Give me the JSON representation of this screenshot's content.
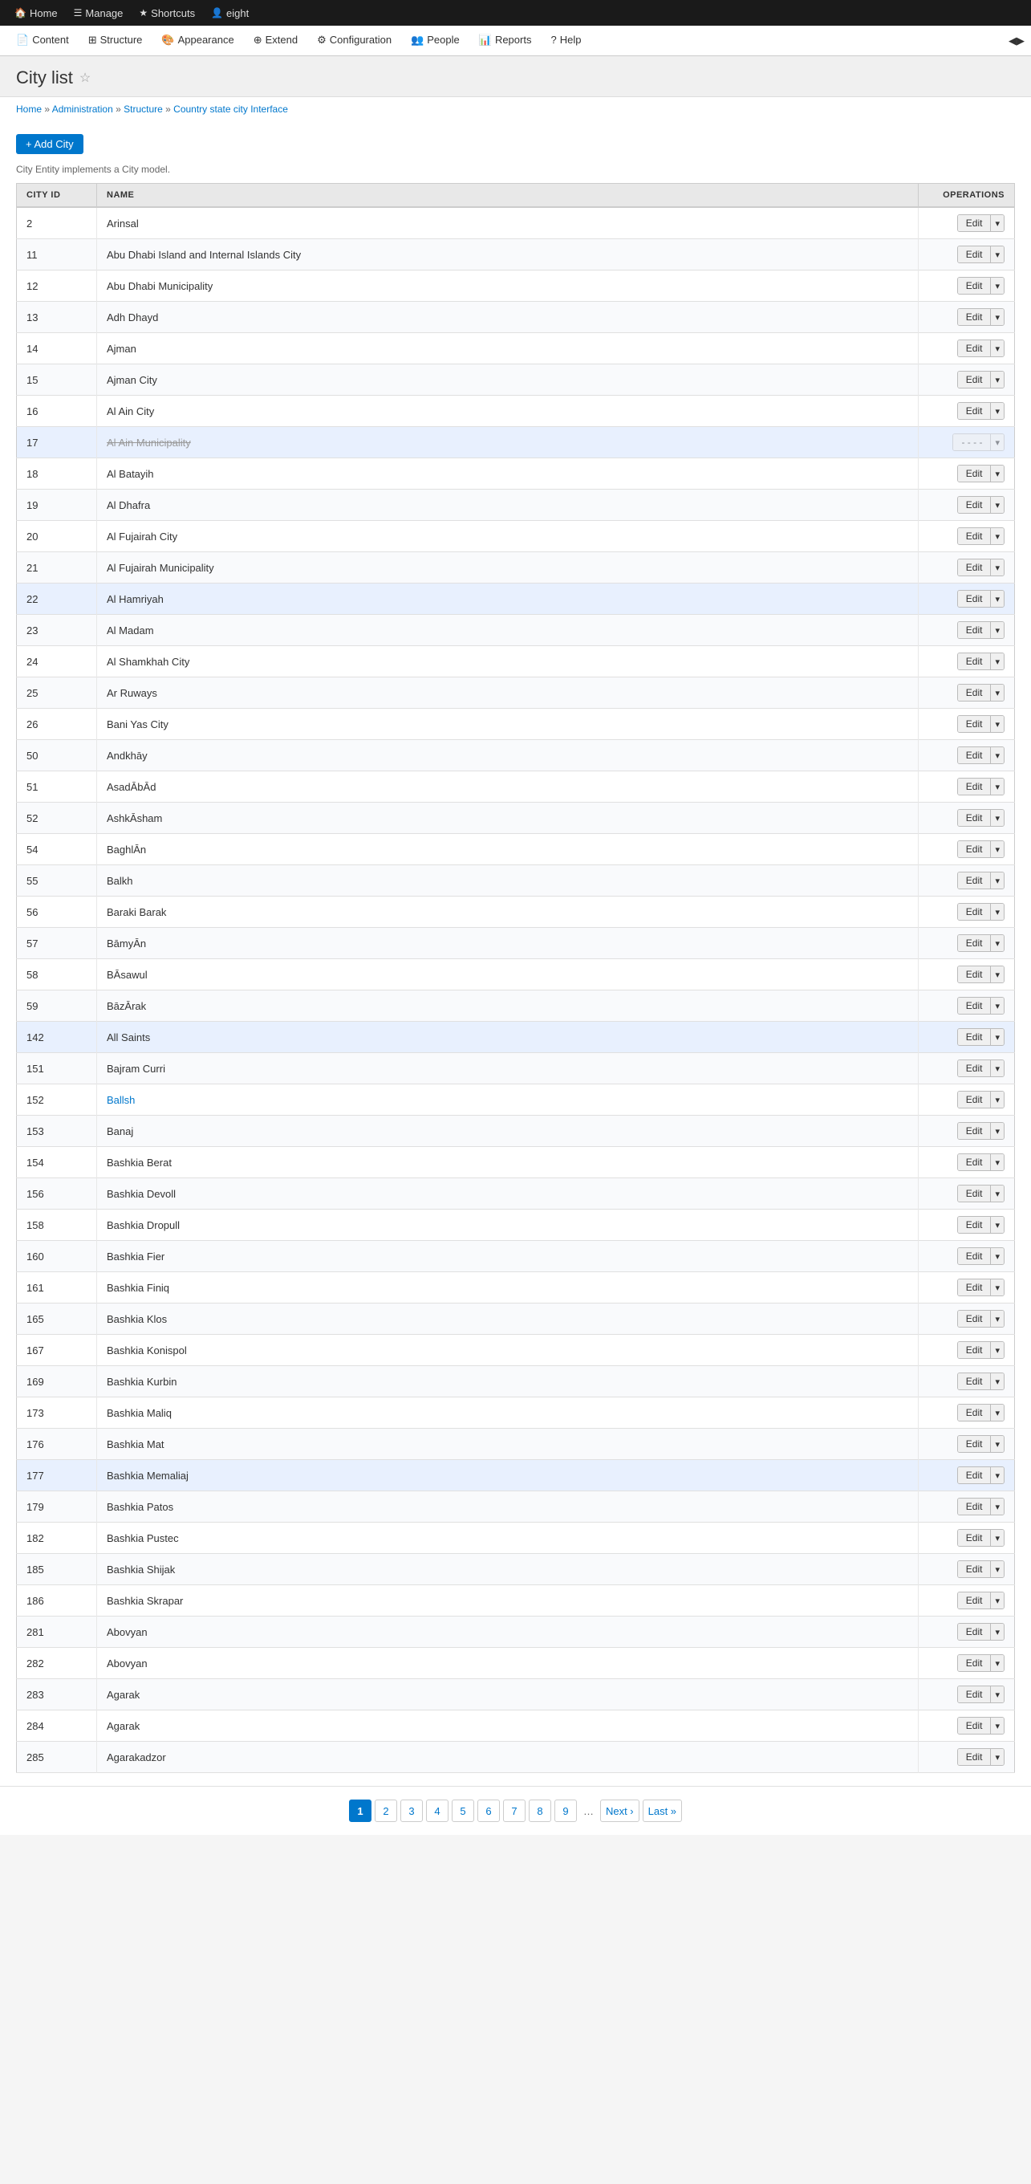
{
  "top_nav": {
    "items": [
      {
        "id": "home",
        "label": "Home",
        "icon": "🏠"
      },
      {
        "id": "manage",
        "label": "Manage",
        "icon": "☰"
      },
      {
        "id": "shortcuts",
        "label": "Shortcuts",
        "icon": "★"
      },
      {
        "id": "user",
        "label": "eight",
        "icon": "👤"
      }
    ]
  },
  "sec_nav": {
    "items": [
      {
        "id": "content",
        "label": "Content",
        "icon": "📄"
      },
      {
        "id": "structure",
        "label": "Structure",
        "icon": "⊞"
      },
      {
        "id": "appearance",
        "label": "Appearance",
        "icon": "🎨"
      },
      {
        "id": "extend",
        "label": "Extend",
        "icon": "⊕"
      },
      {
        "id": "configuration",
        "label": "Configuration",
        "icon": "⚙"
      },
      {
        "id": "people",
        "label": "People",
        "icon": "👥"
      },
      {
        "id": "reports",
        "label": "Reports",
        "icon": "📊"
      },
      {
        "id": "help",
        "label": "Help",
        "icon": "?"
      }
    ]
  },
  "page": {
    "title": "City list",
    "entity_info": "City Entity implements a City model.",
    "add_button_label": "+ Add City"
  },
  "breadcrumb": {
    "items": [
      {
        "label": "Home",
        "href": "#"
      },
      {
        "label": "Administration",
        "href": "#"
      },
      {
        "label": "Structure",
        "href": "#"
      },
      {
        "label": "Country state city Interface",
        "href": "#"
      }
    ]
  },
  "table": {
    "columns": [
      "CITY ID",
      "NAME",
      "OPERATIONS"
    ],
    "rows": [
      {
        "id": "2",
        "name": "Arinsal",
        "highlighted": false
      },
      {
        "id": "11",
        "name": "Abu Dhabi Island and Internal Islands City",
        "highlighted": false
      },
      {
        "id": "12",
        "name": "Abu Dhabi Municipality",
        "highlighted": false
      },
      {
        "id": "13",
        "name": "Adh Dhayd",
        "highlighted": false
      },
      {
        "id": "14",
        "name": "Ajman",
        "highlighted": false
      },
      {
        "id": "15",
        "name": "Ajman City",
        "highlighted": false
      },
      {
        "id": "16",
        "name": "Al Ain City",
        "highlighted": false
      },
      {
        "id": "17",
        "name": "Al Ain Municipality",
        "highlighted": true
      },
      {
        "id": "18",
        "name": "Al Batayih",
        "highlighted": false
      },
      {
        "id": "19",
        "name": "Al Dhafra",
        "highlighted": false
      },
      {
        "id": "20",
        "name": "Al Fujairah City",
        "highlighted": false
      },
      {
        "id": "21",
        "name": "Al Fujairah Municipality",
        "highlighted": false
      },
      {
        "id": "22",
        "name": "Al Hamriyah",
        "highlighted": true
      },
      {
        "id": "23",
        "name": "Al Madam",
        "highlighted": false
      },
      {
        "id": "24",
        "name": "Al Shamkhah City",
        "highlighted": false
      },
      {
        "id": "25",
        "name": "Ar Ruways",
        "highlighted": false
      },
      {
        "id": "26",
        "name": "Bani Yas City",
        "highlighted": false
      },
      {
        "id": "50",
        "name": "Andkhāy",
        "highlighted": false
      },
      {
        "id": "51",
        "name": "AsadĀbĀd",
        "highlighted": false
      },
      {
        "id": "52",
        "name": "AshkĀsham",
        "highlighted": false
      },
      {
        "id": "54",
        "name": "BaghlĀn",
        "highlighted": false
      },
      {
        "id": "55",
        "name": "Balkh",
        "highlighted": false
      },
      {
        "id": "56",
        "name": "Baraki Barak",
        "highlighted": false
      },
      {
        "id": "57",
        "name": "BāmyĀn",
        "highlighted": false
      },
      {
        "id": "58",
        "name": "BĀsawul",
        "highlighted": false
      },
      {
        "id": "59",
        "name": "BāzĀrak",
        "highlighted": false
      },
      {
        "id": "142",
        "name": "All Saints",
        "highlighted": true
      },
      {
        "id": "151",
        "name": "Bajram Curri",
        "highlighted": false
      },
      {
        "id": "152",
        "name": "Ballsh",
        "highlighted": false
      },
      {
        "id": "153",
        "name": "Banaj",
        "highlighted": false
      },
      {
        "id": "154",
        "name": "Bashkia Berat",
        "highlighted": false
      },
      {
        "id": "156",
        "name": "Bashkia Devoll",
        "highlighted": false
      },
      {
        "id": "158",
        "name": "Bashkia Dropull",
        "highlighted": false
      },
      {
        "id": "160",
        "name": "Bashkia Fier",
        "highlighted": false
      },
      {
        "id": "161",
        "name": "Bashkia Finiq",
        "highlighted": false
      },
      {
        "id": "165",
        "name": "Bashkia Klos",
        "highlighted": false
      },
      {
        "id": "167",
        "name": "Bashkia Konispol",
        "highlighted": false
      },
      {
        "id": "169",
        "name": "Bashkia Kurbin",
        "highlighted": false
      },
      {
        "id": "173",
        "name": "Bashkia Maliq",
        "highlighted": false
      },
      {
        "id": "176",
        "name": "Bashkia Mat",
        "highlighted": false
      },
      {
        "id": "177",
        "name": "Bashkia Memaliaj",
        "highlighted": true
      },
      {
        "id": "179",
        "name": "Bashkia Patos",
        "highlighted": false
      },
      {
        "id": "182",
        "name": "Bashkia Pustec",
        "highlighted": false
      },
      {
        "id": "185",
        "name": "Bashkia Shijak",
        "highlighted": false
      },
      {
        "id": "186",
        "name": "Bashkia Skrapar",
        "highlighted": false
      },
      {
        "id": "281",
        "name": "Abovyan",
        "highlighted": false
      },
      {
        "id": "282",
        "name": "Abovyan",
        "highlighted": false
      },
      {
        "id": "283",
        "name": "Agarak",
        "highlighted": false
      },
      {
        "id": "284",
        "name": "Agarak",
        "highlighted": false
      },
      {
        "id": "285",
        "name": "Agarakadzor",
        "highlighted": false
      }
    ]
  },
  "pagination": {
    "current": 1,
    "pages": [
      "1",
      "2",
      "3",
      "4",
      "5",
      "6",
      "7",
      "8",
      "9"
    ],
    "dots": "…",
    "next_label": "Next ›",
    "last_label": "Last »"
  },
  "operations": {
    "edit_label": "Edit",
    "dropdown_icon": "▾"
  }
}
